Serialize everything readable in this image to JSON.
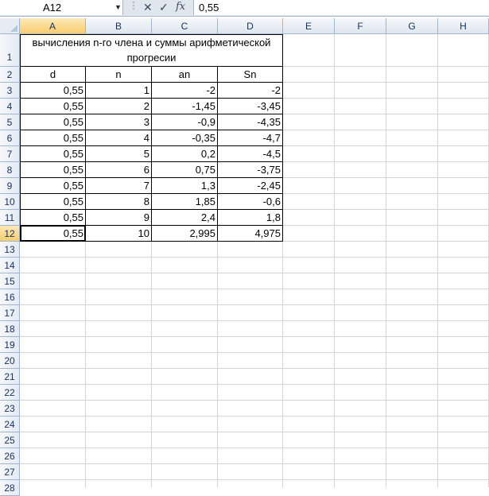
{
  "formula_bar": {
    "name_box": "A12",
    "name_box_arrow": "▼",
    "formula": "0,55",
    "fx_label": "fx"
  },
  "columns": [
    "A",
    "B",
    "C",
    "D",
    "E",
    "F",
    "G",
    "H"
  ],
  "rows": [
    "1",
    "2",
    "3",
    "4",
    "5",
    "6",
    "7",
    "8",
    "9",
    "10",
    "11",
    "12",
    "13",
    "14",
    "15",
    "16",
    "17",
    "18",
    "19",
    "20",
    "21",
    "22",
    "23",
    "24",
    "25",
    "26",
    "27",
    "28"
  ],
  "title_text": "вычисления n-го члена и суммы арифметической прогресии",
  "headers": [
    "d",
    "n",
    "an",
    "Sn"
  ],
  "table": [
    [
      "0,55",
      "1",
      "-2",
      "-2"
    ],
    [
      "0,55",
      "2",
      "-1,45",
      "-3,45"
    ],
    [
      "0,55",
      "3",
      "-0,9",
      "-4,35"
    ],
    [
      "0,55",
      "4",
      "-0,35",
      "-4,7"
    ],
    [
      "0,55",
      "5",
      "0,2",
      "-4,5"
    ],
    [
      "0,55",
      "6",
      "0,75",
      "-3,75"
    ],
    [
      "0,55",
      "7",
      "1,3",
      "-2,45"
    ],
    [
      "0,55",
      "8",
      "1,85",
      "-0,6"
    ],
    [
      "0,55",
      "9",
      "2,4",
      "1,8"
    ],
    [
      "0,55",
      "10",
      "2,995",
      "4,975"
    ]
  ],
  "selected_cell": "A12",
  "colors": {
    "header_bg": "#e4eaf2",
    "selected_header": "#f9cd6e",
    "grid": "#d4d4d4"
  }
}
